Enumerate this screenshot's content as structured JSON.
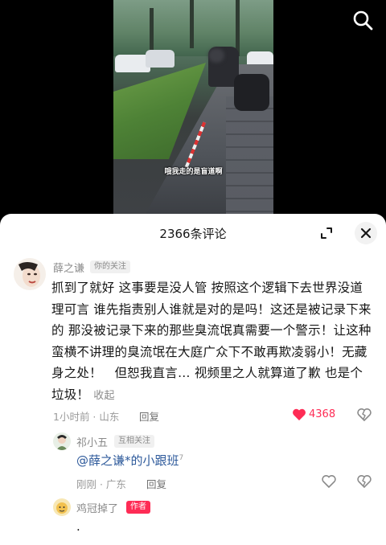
{
  "video": {
    "subtitle": "哦我走的是盲道啊"
  },
  "header": {
    "comment_count_label": "2366条评论"
  },
  "comments": [
    {
      "author": "薛之谦",
      "relation_tag": "你的关注",
      "text": "抓到了就好 这事要是没人管 按照这个逻辑下去世界没道理可言 谁先指责别人谁就是对的是吗！这还是被记录下来的 那没被记录下来的那些臭流氓真需要一个警示！让这种蛮横不讲理的臭流氓在大庭广众下不敢再欺凌弱小！无藏身之处！　但恕我直言… 视频里之人就算道了歉 也是个垃圾！",
      "collapse_label": "收起",
      "meta": "1小时前 · 山东",
      "reply_label": "回复",
      "likes": "4368"
    },
    {
      "author": "祁小五",
      "relation_tag": "互相关注",
      "text": "@薛之谦*的小跟班",
      "superscript": "7",
      "meta": "刚刚 · 广东",
      "reply_label": "回复"
    },
    {
      "author": "鸡冠掉了",
      "relation_tag": "作者",
      "text": "."
    }
  ],
  "icons": {
    "search": "search-icon",
    "expand": "expand-icon",
    "close": "close-icon",
    "like": "heart-icon",
    "dislike": "broken-heart-icon"
  },
  "colors": {
    "like_active": "#fe2c55",
    "mention": "#2e5a9b"
  }
}
